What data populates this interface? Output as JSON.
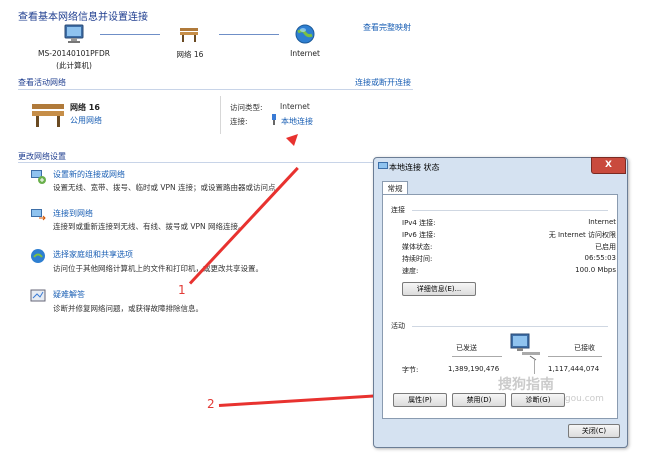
{
  "header": {
    "title": "查看基本网络信息并设置连接",
    "full_map_link": "查看完整映射"
  },
  "map": {
    "computer_name": "MS-20140101PFDR",
    "computer_sub": "(此计算机)",
    "network_name": "网络  16",
    "internet": "Internet"
  },
  "active": {
    "section_title": "查看活动网络",
    "connect_link": "连接或断开连接",
    "network_name": "网络  16",
    "network_type": "公用网络",
    "access_type_label": "访问类型:",
    "access_type_value": "Internet",
    "connection_label": "连接:",
    "connection_value": "本地连接"
  },
  "settings": {
    "section_title": "更改网络设置",
    "tasks": [
      {
        "title": "设置新的连接或网络",
        "desc": "设置无线、宽带、拨号、临时或 VPN 连接；或设置路由器或访问点。"
      },
      {
        "title": "连接到网络",
        "desc": "连接到或重新连接到无线、有线、拨号或 VPN 网络连接。"
      },
      {
        "title": "选择家庭组和共享选项",
        "desc": "访问位于其他网络计算机上的文件和打印机，或更改共享设置。"
      },
      {
        "title": "疑难解答",
        "desc": "诊断并修复网络问题，或获得故障排除信息。"
      }
    ]
  },
  "annotations": {
    "one": "1",
    "two": "2"
  },
  "dialog": {
    "title": "本地连接 状态",
    "close_glyph": "X",
    "tab": "常规",
    "connection_header": "连接",
    "rows": [
      {
        "label": "IPv4 连接:",
        "value": "Internet"
      },
      {
        "label": "IPv6 连接:",
        "value": "无 Internet 访问权限"
      },
      {
        "label": "媒体状态:",
        "value": "已启用"
      },
      {
        "label": "持续时间:",
        "value": "06:55:03"
      },
      {
        "label": "速度:",
        "value": "100.0 Mbps"
      }
    ],
    "details_button": "详细信息(E)...",
    "activity_header": "活动",
    "sent_label": "已发送",
    "received_label": "已接收",
    "bytes_label": "字节:",
    "bytes_sent": "1,389,190,476",
    "bytes_received": "1,117,444,074",
    "properties_button": "属性(P)",
    "disable_button": "禁用(D)",
    "diagnose_button": "诊断(G)",
    "close_button": "关闭(C)",
    "watermark": "搜狗指南",
    "watermark_url": "zhinan.sogou.com"
  },
  "colors": {
    "link": "#1a5fb4",
    "heading": "#1e3d8f",
    "arrow": "#e8322f",
    "dialog_frame": "#d5e2f1"
  }
}
